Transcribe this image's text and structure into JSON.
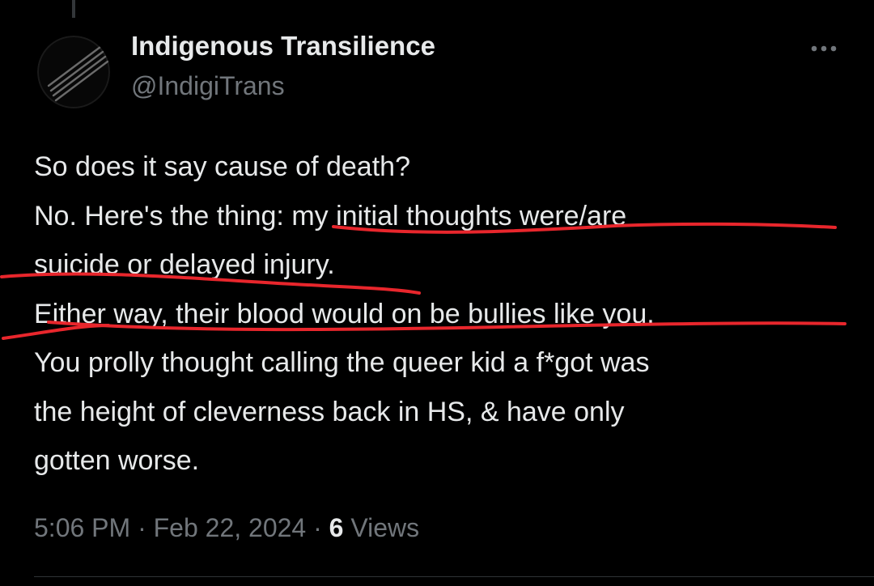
{
  "author": {
    "display_name": "Indigenous Transilience",
    "handle": "@IndigiTrans",
    "avatar_icon": "striped-logo-icon"
  },
  "more_icon": "ellipsis-icon",
  "tweet": {
    "lines": [
      "So does it say cause of death?",
      "No. Here's the thing: my initial thoughts were/are",
      "suicide or delayed injury.",
      "Either way, their blood would on be bullies like you.",
      "You prolly thought calling the queer kid a f*got was",
      "the height of cleverness back in HS, & have only",
      "gotten worse."
    ]
  },
  "annotation": {
    "color": "#e8262c",
    "highlighted_lines": [
      1,
      2,
      3
    ]
  },
  "meta": {
    "time": "5:06 PM",
    "date": "Feb 22, 2024",
    "separator": "·",
    "views_count": "6",
    "views_label": "Views"
  }
}
